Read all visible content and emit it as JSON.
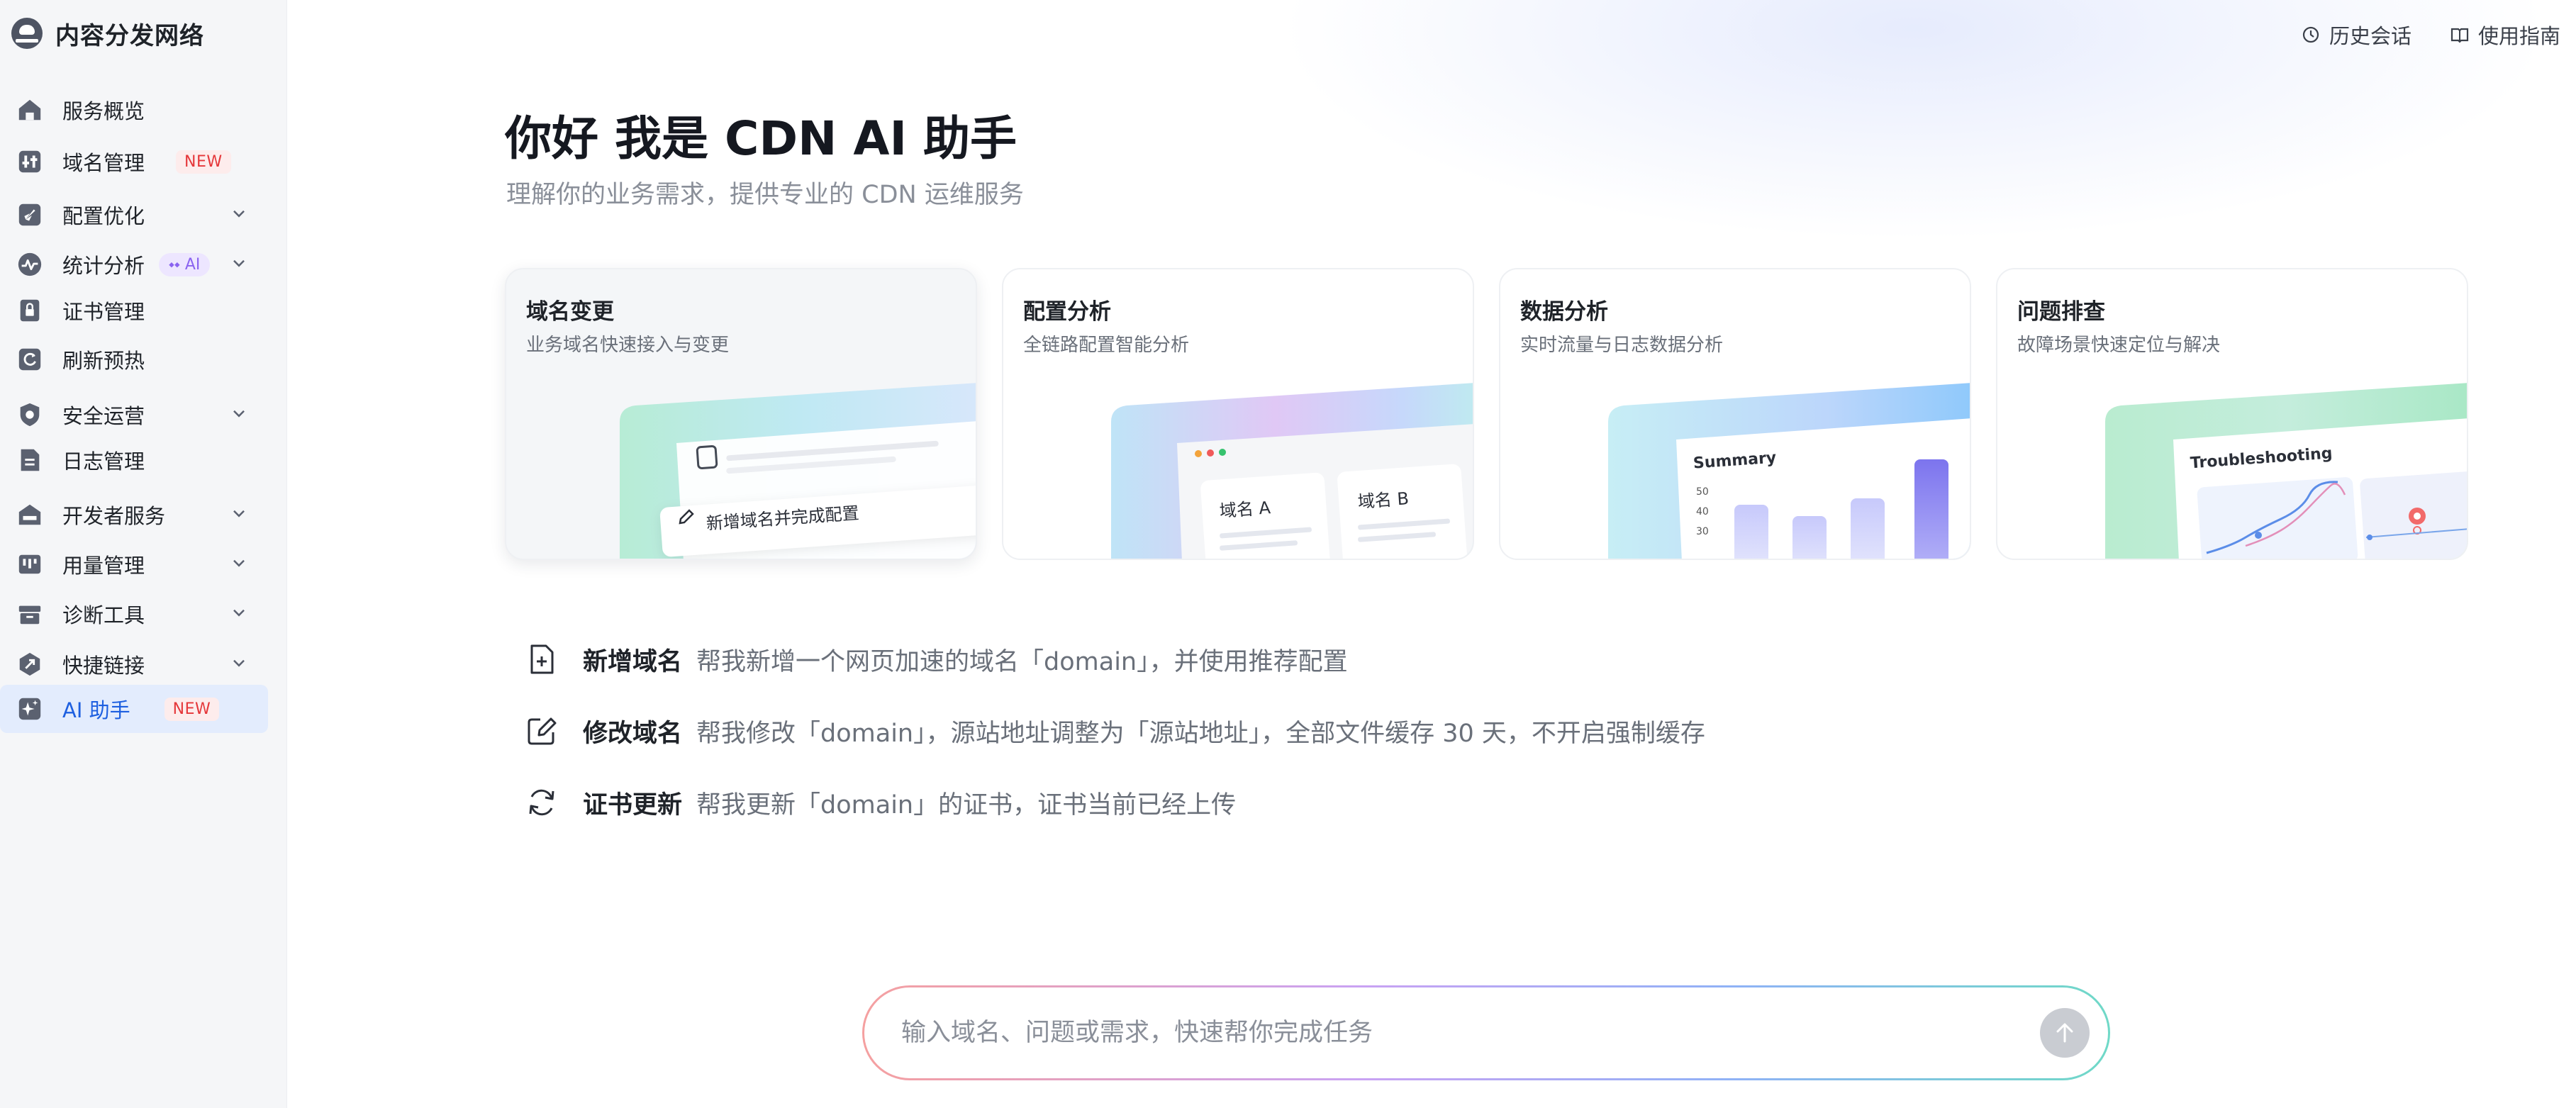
{
  "brand": {
    "title": "内容分发网络"
  },
  "sidebar": {
    "items": [
      {
        "label": "服务概览",
        "icon": "home-icon"
      },
      {
        "label": "域名管理",
        "icon": "domain-icon",
        "badge": "NEW"
      },
      {
        "label": "配置优化",
        "icon": "rocket-icon"
      },
      {
        "label": "统计分析",
        "icon": "chart-icon",
        "badge": "AI"
      },
      {
        "label": "证书管理",
        "icon": "lock-icon"
      },
      {
        "label": "刷新预热",
        "icon": "refresh-icon"
      },
      {
        "label": "安全运营",
        "icon": "shield-icon"
      },
      {
        "label": "日志管理",
        "icon": "document-icon"
      },
      {
        "label": "开发者服务",
        "icon": "developer-icon"
      },
      {
        "label": "用量管理",
        "icon": "usage-icon"
      },
      {
        "label": "诊断工具",
        "icon": "toolbox-icon"
      },
      {
        "label": "快捷链接",
        "icon": "link-icon"
      },
      {
        "label": "AI 助手",
        "icon": "ai-sparkle-icon",
        "badge": "NEW"
      }
    ]
  },
  "header": {
    "history_label": "历史会话",
    "guide_label": "使用指南"
  },
  "hero": {
    "title": "你好 我是 CDN AI 助手",
    "subtitle": "理解你的业务需求，提供专业的 CDN 运维服务"
  },
  "cards": [
    {
      "title": "域名变更",
      "desc": "业务域名快速接入与变更",
      "art_text": "新增域名并完成配置"
    },
    {
      "title": "配置分析",
      "desc": "全链路配置智能分析",
      "art_a": "域名 A",
      "art_b": "域名 B"
    },
    {
      "title": "数据分析",
      "desc": "实时流量与日志数据分析",
      "art_title": "Summary",
      "art_ticks": [
        "50",
        "40",
        "30"
      ]
    },
    {
      "title": "问题排查",
      "desc": "故障场景快速定位与解决",
      "art_title": "Troubleshooting"
    }
  ],
  "suggestions": [
    {
      "title": "新增域名",
      "text": "帮我新增一个网页加速的域名「domain」，并使用推荐配置"
    },
    {
      "title": "修改域名",
      "text": "帮我修改「domain」，源站地址调整为「源站地址」，全部文件缓存 30 天，不开启强制缓存"
    },
    {
      "title": "证书更新",
      "text": "帮我更新「domain」的证书，证书当前已经上传"
    }
  ],
  "input": {
    "placeholder": "输入域名、问题或需求，快速帮你完成任务"
  },
  "colors": {
    "accent": "#1d5fe0",
    "active_bg": "#e3ecfd",
    "new_badge": "#e5373a",
    "ai_badge": "#8a63f0"
  }
}
